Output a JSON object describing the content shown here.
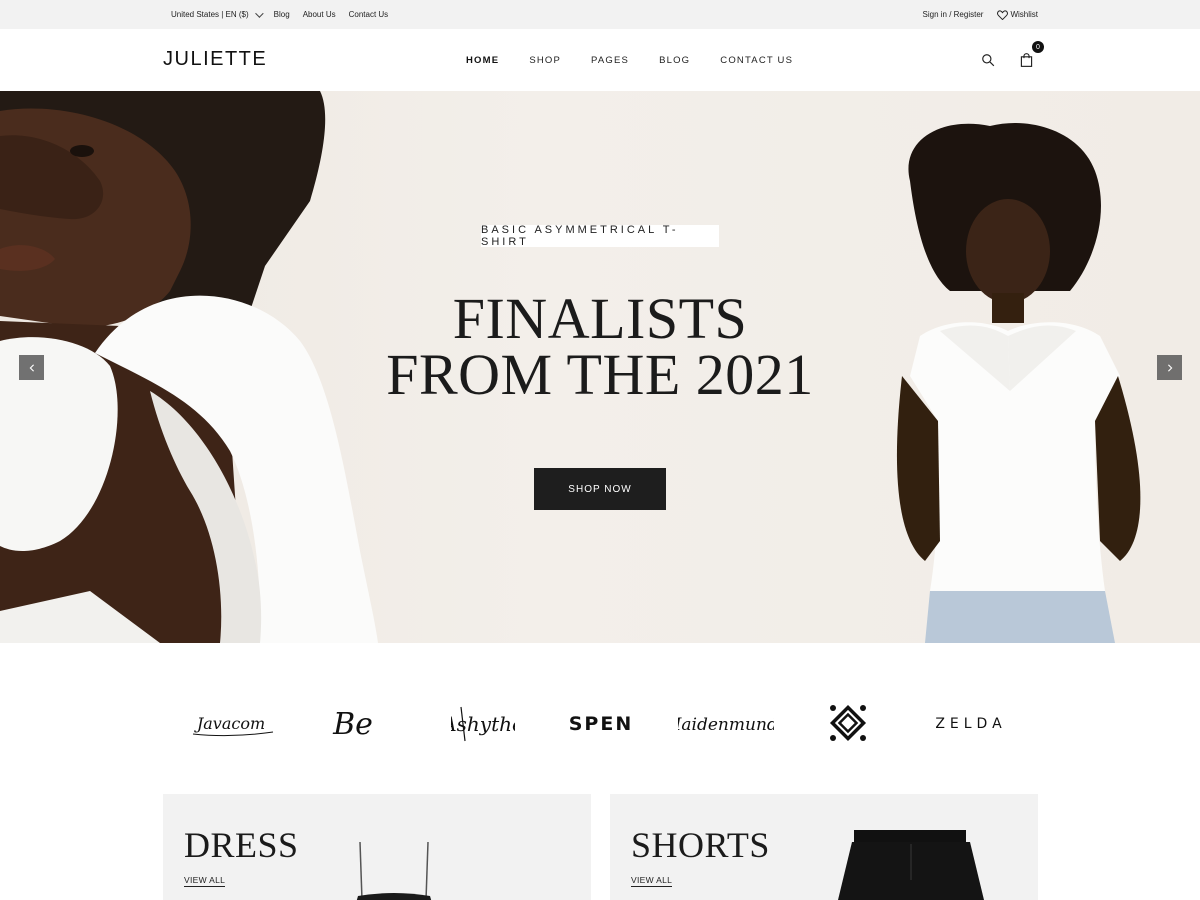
{
  "topbar": {
    "locale": "United States | EN ($)",
    "links": [
      "Blog",
      "About Us",
      "Contact Us"
    ],
    "signin": "Sign in / Register",
    "wishlist": "Wishlist"
  },
  "header": {
    "logo": "JULIETTE",
    "nav": [
      "HOME",
      "SHOP",
      "PAGES",
      "BLOG",
      "CONTACT US"
    ],
    "active_nav": "HOME",
    "cart_count": "0"
  },
  "hero": {
    "tagline": "BASIC ASYMMETRICAL T-SHIRT",
    "title_line1": "FINALISTS",
    "title_line2": "FROM THE 2021",
    "cta": "SHOP NOW"
  },
  "brands": [
    "Javacom",
    "Be",
    "Ashythe",
    "SPEN",
    "Maidenmundo",
    "brand-mark",
    "ZELDA"
  ],
  "categories": [
    {
      "title": "DRESS",
      "link": "VIEW ALL"
    },
    {
      "title": "SHORTS",
      "link": "VIEW ALL"
    }
  ],
  "colors": {
    "topbar_bg": "#f2f2f2",
    "hero_bg": "#f1ece6",
    "cta_bg": "#1e1e1e",
    "category_bg": "#f2f2f2"
  }
}
